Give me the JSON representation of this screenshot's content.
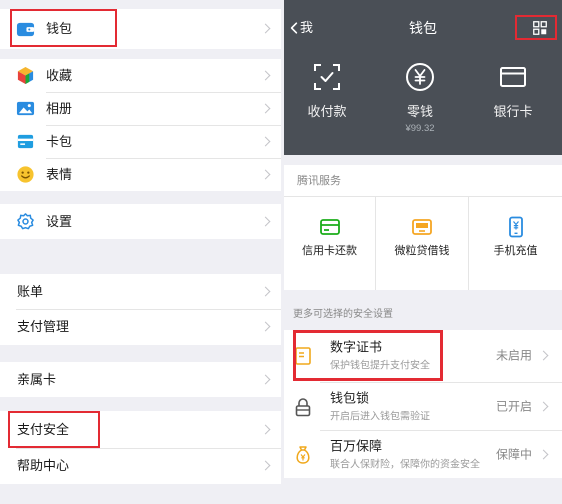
{
  "colors": {
    "page_bg": "#efeff4",
    "header_bg": "#4a4f56",
    "highlight": "#e32a33",
    "accent_green": "#1aad19",
    "accent_blue": "#2a8ce0",
    "accent_orange": "#f5a623"
  },
  "me_menu": {
    "wallet": {
      "label": "钱包",
      "icon": "wallet-icon"
    },
    "items": [
      {
        "label": "收藏",
        "icon": "favorites-icon"
      },
      {
        "label": "相册",
        "icon": "album-icon"
      },
      {
        "label": "卡包",
        "icon": "card-pack-icon"
      },
      {
        "label": "表情",
        "icon": "sticker-icon"
      }
    ],
    "settings": {
      "label": "设置",
      "icon": "settings-icon"
    }
  },
  "wallet_menu": {
    "items": [
      {
        "label": "账单"
      },
      {
        "label": "支付管理"
      },
      {
        "label": "亲属卡"
      },
      {
        "label": "支付安全"
      },
      {
        "label": "帮助中心"
      }
    ]
  },
  "wallet_page": {
    "nav": {
      "back_label": "我",
      "title": "钱包",
      "back_icon": "chevron-left-icon",
      "more_icon": "grid-menu-icon"
    },
    "actions": [
      {
        "label": "收付款",
        "icon": "scan-pay-icon"
      },
      {
        "label": "零钱",
        "icon": "yuan-coin-icon",
        "amount": "¥99.32"
      },
      {
        "label": "银行卡",
        "icon": "bank-card-icon"
      }
    ],
    "tencent_services": {
      "heading": "腾讯服务",
      "items": [
        {
          "label": "信用卡还款",
          "icon": "credit-card-repay-icon"
        },
        {
          "label": "微粒贷借钱",
          "icon": "weilidai-loan-icon"
        },
        {
          "label": "手机充值",
          "icon": "mobile-topup-icon"
        }
      ]
    },
    "security": {
      "heading": "更多可选择的安全设置",
      "items": [
        {
          "title": "数字证书",
          "subtitle": "保护钱包提升支付安全",
          "status": "未启用",
          "icon": "certificate-icon"
        },
        {
          "title": "钱包锁",
          "subtitle": "开启后进入钱包需验证",
          "status": "已开启",
          "icon": "lock-icon"
        },
        {
          "title": "百万保障",
          "subtitle": "联合人保财险，保障你的资金安全",
          "status": "保障中",
          "icon": "insurance-bag-icon"
        }
      ]
    }
  }
}
